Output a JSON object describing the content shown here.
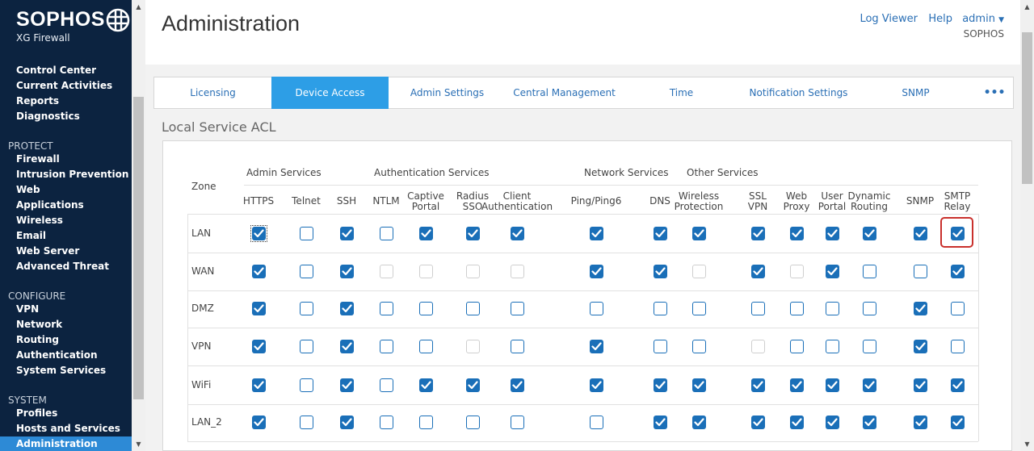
{
  "app": {
    "brand": "SOPHOS",
    "product": "XG Firewall"
  },
  "sidebar": {
    "sections": [
      {
        "label": "",
        "items": [
          "Control Center",
          "Current Activities",
          "Reports",
          "Diagnostics"
        ]
      },
      {
        "label": "PROTECT",
        "items": [
          "Firewall",
          "Intrusion Prevention",
          "Web",
          "Applications",
          "Wireless",
          "Email",
          "Web Server",
          "Advanced Threat"
        ]
      },
      {
        "label": "CONFIGURE",
        "items": [
          "VPN",
          "Network",
          "Routing",
          "Authentication",
          "System Services"
        ]
      },
      {
        "label": "SYSTEM",
        "items": [
          "Profiles",
          "Hosts and Services",
          "Administration"
        ]
      }
    ],
    "active": "Administration"
  },
  "header": {
    "title": "Administration",
    "log_viewer": "Log Viewer",
    "help": "Help",
    "user": "admin",
    "org": "SOPHOS"
  },
  "tabs": [
    "Licensing",
    "Device Access",
    "Admin Settings",
    "Central Management",
    "Time",
    "Notification Settings",
    "SNMP"
  ],
  "active_tab": "Device Access",
  "section_title": "Local Service ACL",
  "acl": {
    "zone_header": "Zone",
    "groups": [
      "Admin Services",
      "Authentication Services",
      "Network Services",
      "Other Services"
    ],
    "columns": [
      {
        "key": "https",
        "label": "HTTPS"
      },
      {
        "key": "telnet",
        "label": "Telnet"
      },
      {
        "key": "ssh",
        "label": "SSH"
      },
      {
        "key": "ntlm",
        "label": "NTLM"
      },
      {
        "key": "captive",
        "label": "Captive\nPortal"
      },
      {
        "key": "radius",
        "label": "Radius\nSSO"
      },
      {
        "key": "client_auth",
        "label": "Client\nAuthentication"
      },
      {
        "key": "ping",
        "label": "Ping/Ping6"
      },
      {
        "key": "dns",
        "label": "DNS"
      },
      {
        "key": "wireless",
        "label": "Wireless\nProtection"
      },
      {
        "key": "sslvpn",
        "label": "SSL\nVPN"
      },
      {
        "key": "webproxy",
        "label": "Web\nProxy"
      },
      {
        "key": "userportal",
        "label": "User\nPortal"
      },
      {
        "key": "dynrouting",
        "label": "Dynamic\nRouting"
      },
      {
        "key": "snmp",
        "label": "SNMP"
      },
      {
        "key": "smtp",
        "label": "SMTP\nRelay"
      }
    ],
    "rows": [
      {
        "zone": "LAN",
        "states": [
          "on",
          "off",
          "on",
          "off",
          "on",
          "on",
          "on",
          "on",
          "on",
          "on",
          "on",
          "on",
          "on",
          "on",
          "on",
          "on"
        ]
      },
      {
        "zone": "WAN",
        "states": [
          "on",
          "off",
          "on",
          "dis",
          "dis",
          "dis",
          "dis",
          "on",
          "on",
          "dis",
          "on",
          "dis",
          "on",
          "off",
          "off",
          "on"
        ]
      },
      {
        "zone": "DMZ",
        "states": [
          "on",
          "off",
          "on",
          "off",
          "off",
          "off",
          "off",
          "off",
          "off",
          "off",
          "off",
          "off",
          "off",
          "off",
          "on",
          "off"
        ]
      },
      {
        "zone": "VPN",
        "states": [
          "on",
          "off",
          "on",
          "off",
          "off",
          "dis",
          "off",
          "on",
          "off",
          "off",
          "dis",
          "off",
          "off",
          "off",
          "on",
          "off"
        ]
      },
      {
        "zone": "WiFi",
        "states": [
          "on",
          "off",
          "on",
          "off",
          "on",
          "on",
          "on",
          "on",
          "on",
          "on",
          "on",
          "on",
          "on",
          "on",
          "on",
          "on"
        ]
      },
      {
        "zone": "LAN_2",
        "states": [
          "on",
          "off",
          "on",
          "off",
          "off",
          "off",
          "off",
          "off",
          "on",
          "on",
          "on",
          "on",
          "on",
          "on",
          "on",
          "on"
        ]
      }
    ],
    "highlight": {
      "row": "LAN",
      "column": "smtp"
    }
  },
  "colors": {
    "sidebar": "#0c2340",
    "accent": "#2d9ee6",
    "checkbox": "#1a6fb8",
    "highlight": "#c9302c"
  }
}
